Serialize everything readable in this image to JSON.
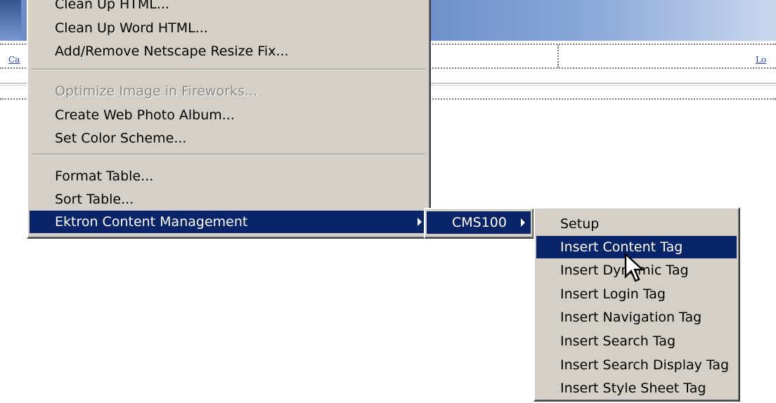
{
  "background": {
    "left_link": "Ca",
    "right_link": "Lo"
  },
  "main_menu": {
    "items": [
      {
        "label": "Clean Up HTML...",
        "state": "normal"
      },
      {
        "label": "Clean Up Word HTML...",
        "state": "normal"
      },
      {
        "label": "Add/Remove Netscape Resize Fix...",
        "state": "normal"
      },
      {
        "label": "Optimize Image in Fireworks...",
        "state": "disabled"
      },
      {
        "label": "Create Web Photo Album...",
        "state": "normal"
      },
      {
        "label": "Set Color Scheme...",
        "state": "normal"
      },
      {
        "label": "Format Table...",
        "state": "normal"
      },
      {
        "label": "Sort Table...",
        "state": "normal"
      },
      {
        "label": "Ektron Content Management",
        "state": "selected",
        "submenu": true
      }
    ]
  },
  "sub_menu": {
    "items": [
      {
        "label": "CMS100",
        "state": "selected",
        "submenu": true
      }
    ]
  },
  "cms_menu": {
    "items": [
      {
        "label": "Setup",
        "state": "normal"
      },
      {
        "label": "Insert Content Tag",
        "state": "selected"
      },
      {
        "label": "Insert Dynamic Tag",
        "state": "normal"
      },
      {
        "label": "Insert Login Tag",
        "state": "normal"
      },
      {
        "label": "Insert Navigation Tag",
        "state": "normal"
      },
      {
        "label": "Insert Search Tag",
        "state": "normal"
      },
      {
        "label": "Insert Search Display Tag",
        "state": "normal"
      },
      {
        "label": "Insert Style Sheet Tag",
        "state": "normal"
      }
    ]
  },
  "colors": {
    "menu_bg": "#d4d0c8",
    "selection": "#0a246a",
    "disabled_text": "#8c8a86"
  },
  "icons": {
    "cursor": "arrow-pointer-icon",
    "submenu": "chevron-right-icon"
  }
}
